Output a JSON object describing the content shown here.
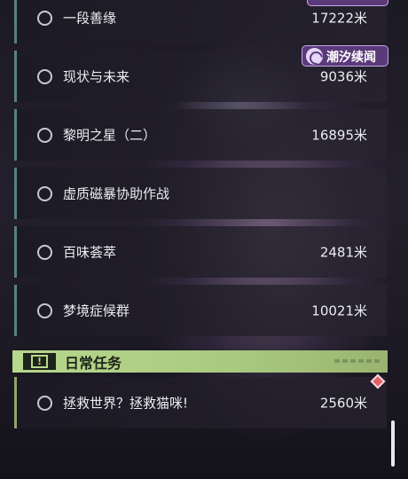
{
  "quests": [
    {
      "name": "一段善缘",
      "distance": "17222米"
    },
    {
      "name": "现状与未来",
      "distance": "9036米"
    },
    {
      "name": "黎明之星（二）",
      "distance": "16895米"
    },
    {
      "name": "虚质磁暴协助作战",
      "distance": ""
    },
    {
      "name": "百味荟萃",
      "distance": "2481米"
    },
    {
      "name": "梦境症候群",
      "distance": "10021米"
    }
  ],
  "daily_section": {
    "title": "日常任务",
    "quests": [
      {
        "name": "拯救世界？拯救猫咪!",
        "distance": "2560米"
      }
    ]
  },
  "watermark": {
    "text": "潮汐续闻"
  },
  "colors": {
    "section_accent": "#b7d88c",
    "row_border": "#5a7f86",
    "watermark_bg": "#5b3a7a",
    "marker": "#e45f6c"
  }
}
